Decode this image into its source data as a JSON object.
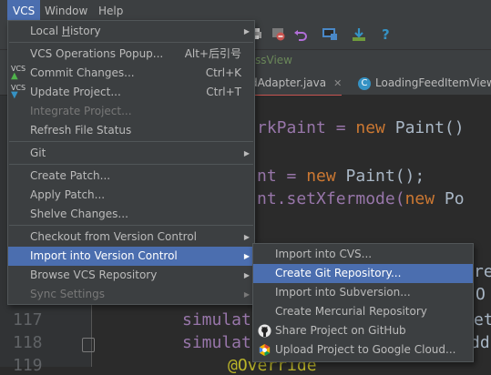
{
  "menubar": {
    "items": [
      "VCS",
      "Window",
      "Help"
    ]
  },
  "breadcrumb": {
    "fragment": "ssView"
  },
  "tabs": [
    {
      "label": "dAdapter.java",
      "close": "✕"
    },
    {
      "label": "LoadingFeedItemView",
      "icon_letter": "C"
    }
  ],
  "editor": {
    "line_numbers": [
      "117",
      "118",
      "119"
    ],
    "lines": {
      "l1": {
        "pre": "rkPaint = ",
        "kw": "new",
        "post": " Paint()"
      },
      "l2": {
        "pre": "nt = ",
        "kw": "new",
        "post": " Paint();"
      },
      "l3": {
        "pre": "nt.setXfermode(",
        "kw": "new",
        "post": " Po"
      },
      "l4": {
        "pre": "simulat",
        "post": "et"
      },
      "l5": {
        "pre": "simulat",
        "post": "dd"
      },
      "l6": {
        "ann": "@Override"
      },
      "right_frag_r": "re",
      "right_frag_o": "O"
    }
  },
  "vcs_menu": {
    "items": [
      {
        "label": "Local History",
        "mnemonic": "H",
        "submenu": true
      },
      {
        "label": "VCS Operations Popup...",
        "shortcut": "Alt+后引号"
      },
      {
        "label": "Commit Changes...",
        "shortcut": "Ctrl+K",
        "icon": "commit-icon"
      },
      {
        "label": "Update Project...",
        "shortcut": "Ctrl+T",
        "icon": "update-icon"
      },
      {
        "label": "Integrate Project...",
        "disabled": true
      },
      {
        "label": "Refresh File Status"
      },
      {
        "label": "Git",
        "submenu": true
      },
      {
        "label": "Create Patch..."
      },
      {
        "label": "Apply Patch..."
      },
      {
        "label": "Shelve Changes..."
      },
      {
        "label": "Checkout from Version Control",
        "submenu": true
      },
      {
        "label": "Import into Version Control",
        "submenu": true,
        "highlighted": true
      },
      {
        "label": "Browse VCS Repository",
        "submenu": true
      },
      {
        "label": "Sync Settings",
        "submenu": true,
        "disabled": true
      }
    ]
  },
  "import_submenu": {
    "items": [
      {
        "label": "Import into CVS..."
      },
      {
        "label": "Create Git Repository...",
        "highlighted": true
      },
      {
        "label": "Import into Subversion..."
      },
      {
        "label": "Create Mercurial Repository"
      },
      {
        "label": "Share Project on GitHub",
        "icon": "github-icon"
      },
      {
        "label": "Upload Project to Google Cloud...",
        "icon": "google-cloud-icon"
      }
    ]
  },
  "colors": {
    "highlight": "#4b6eaf",
    "menu_bg": "#3c3f41",
    "editor_bg": "#2b2b2b",
    "keyword": "#cc7832",
    "field": "#9876aa",
    "annotation": "#bbb529"
  }
}
